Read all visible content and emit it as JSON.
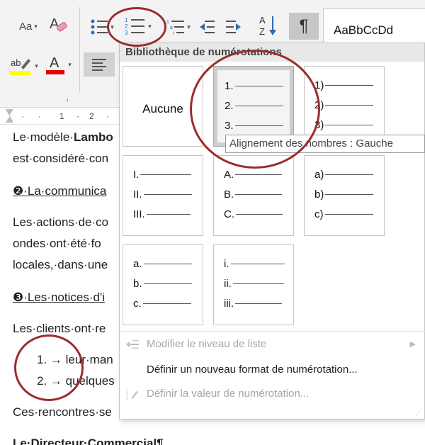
{
  "ribbon": {
    "font_case_label": "Aa",
    "font_color_label": "A",
    "highlight_label": "ab",
    "bullets_icon": "bullets-icon",
    "numbering_icon": "numbering-icon",
    "multilevel_icon": "multilevel-list-icon",
    "decrease_indent_icon": "decrease-indent-icon",
    "increase_indent_icon": "increase-indent-icon",
    "sort_icon": "sort-az-icon",
    "pilcrow_label": "¶",
    "style_preview": "AaBbCcDd",
    "highlight_color": "#ffff00",
    "font_color": "#e00000"
  },
  "ruler": {
    "tick1": "1",
    "tick2": "2"
  },
  "gallery": {
    "title": "Bibliothèque de numérotations",
    "none_label": "Aucune",
    "tooltip": "Alignement des nombres : Gauche",
    "formats": [
      {
        "markers": [
          "1.",
          "2.",
          "3."
        ]
      },
      {
        "markers": [
          "1)",
          "2)",
          "3)"
        ]
      },
      {
        "markers": [
          "I.",
          "II.",
          "III."
        ]
      },
      {
        "markers": [
          "A.",
          "B.",
          "C."
        ]
      },
      {
        "markers": [
          "a)",
          "b)",
          "c)"
        ]
      },
      {
        "markers": [
          "a.",
          "b.",
          "c."
        ]
      },
      {
        "markers": [
          "i.",
          "ii.",
          "iii."
        ]
      }
    ],
    "menu": {
      "change_level": "Modifier le niveau de liste",
      "define_format": "Définir un nouveau format de numérotation...",
      "set_value": "Définir la valeur de numérotation..."
    }
  },
  "document": {
    "l1_prefix": "Le·modèle·",
    "l1_bold": "Lambo",
    "l2": "est·considéré·con",
    "h1": "❷·La·communica",
    "p1": "Les·actions·de·co",
    "p2": "ondes·ont·été·fo",
    "p3": "locales,·dans·une",
    "h2": "❸·Les·notices·d'i",
    "p4": "Les·clients·ont·re",
    "li1_num": "1.",
    "li1_text": "→ leur·man",
    "li2_num": "2.",
    "li2_text": "→ quelques",
    "p5": "Ces·rencontres·se",
    "sig": "Le·Directeur·Commercial¶"
  },
  "annotation_color": "#9b2c2c"
}
